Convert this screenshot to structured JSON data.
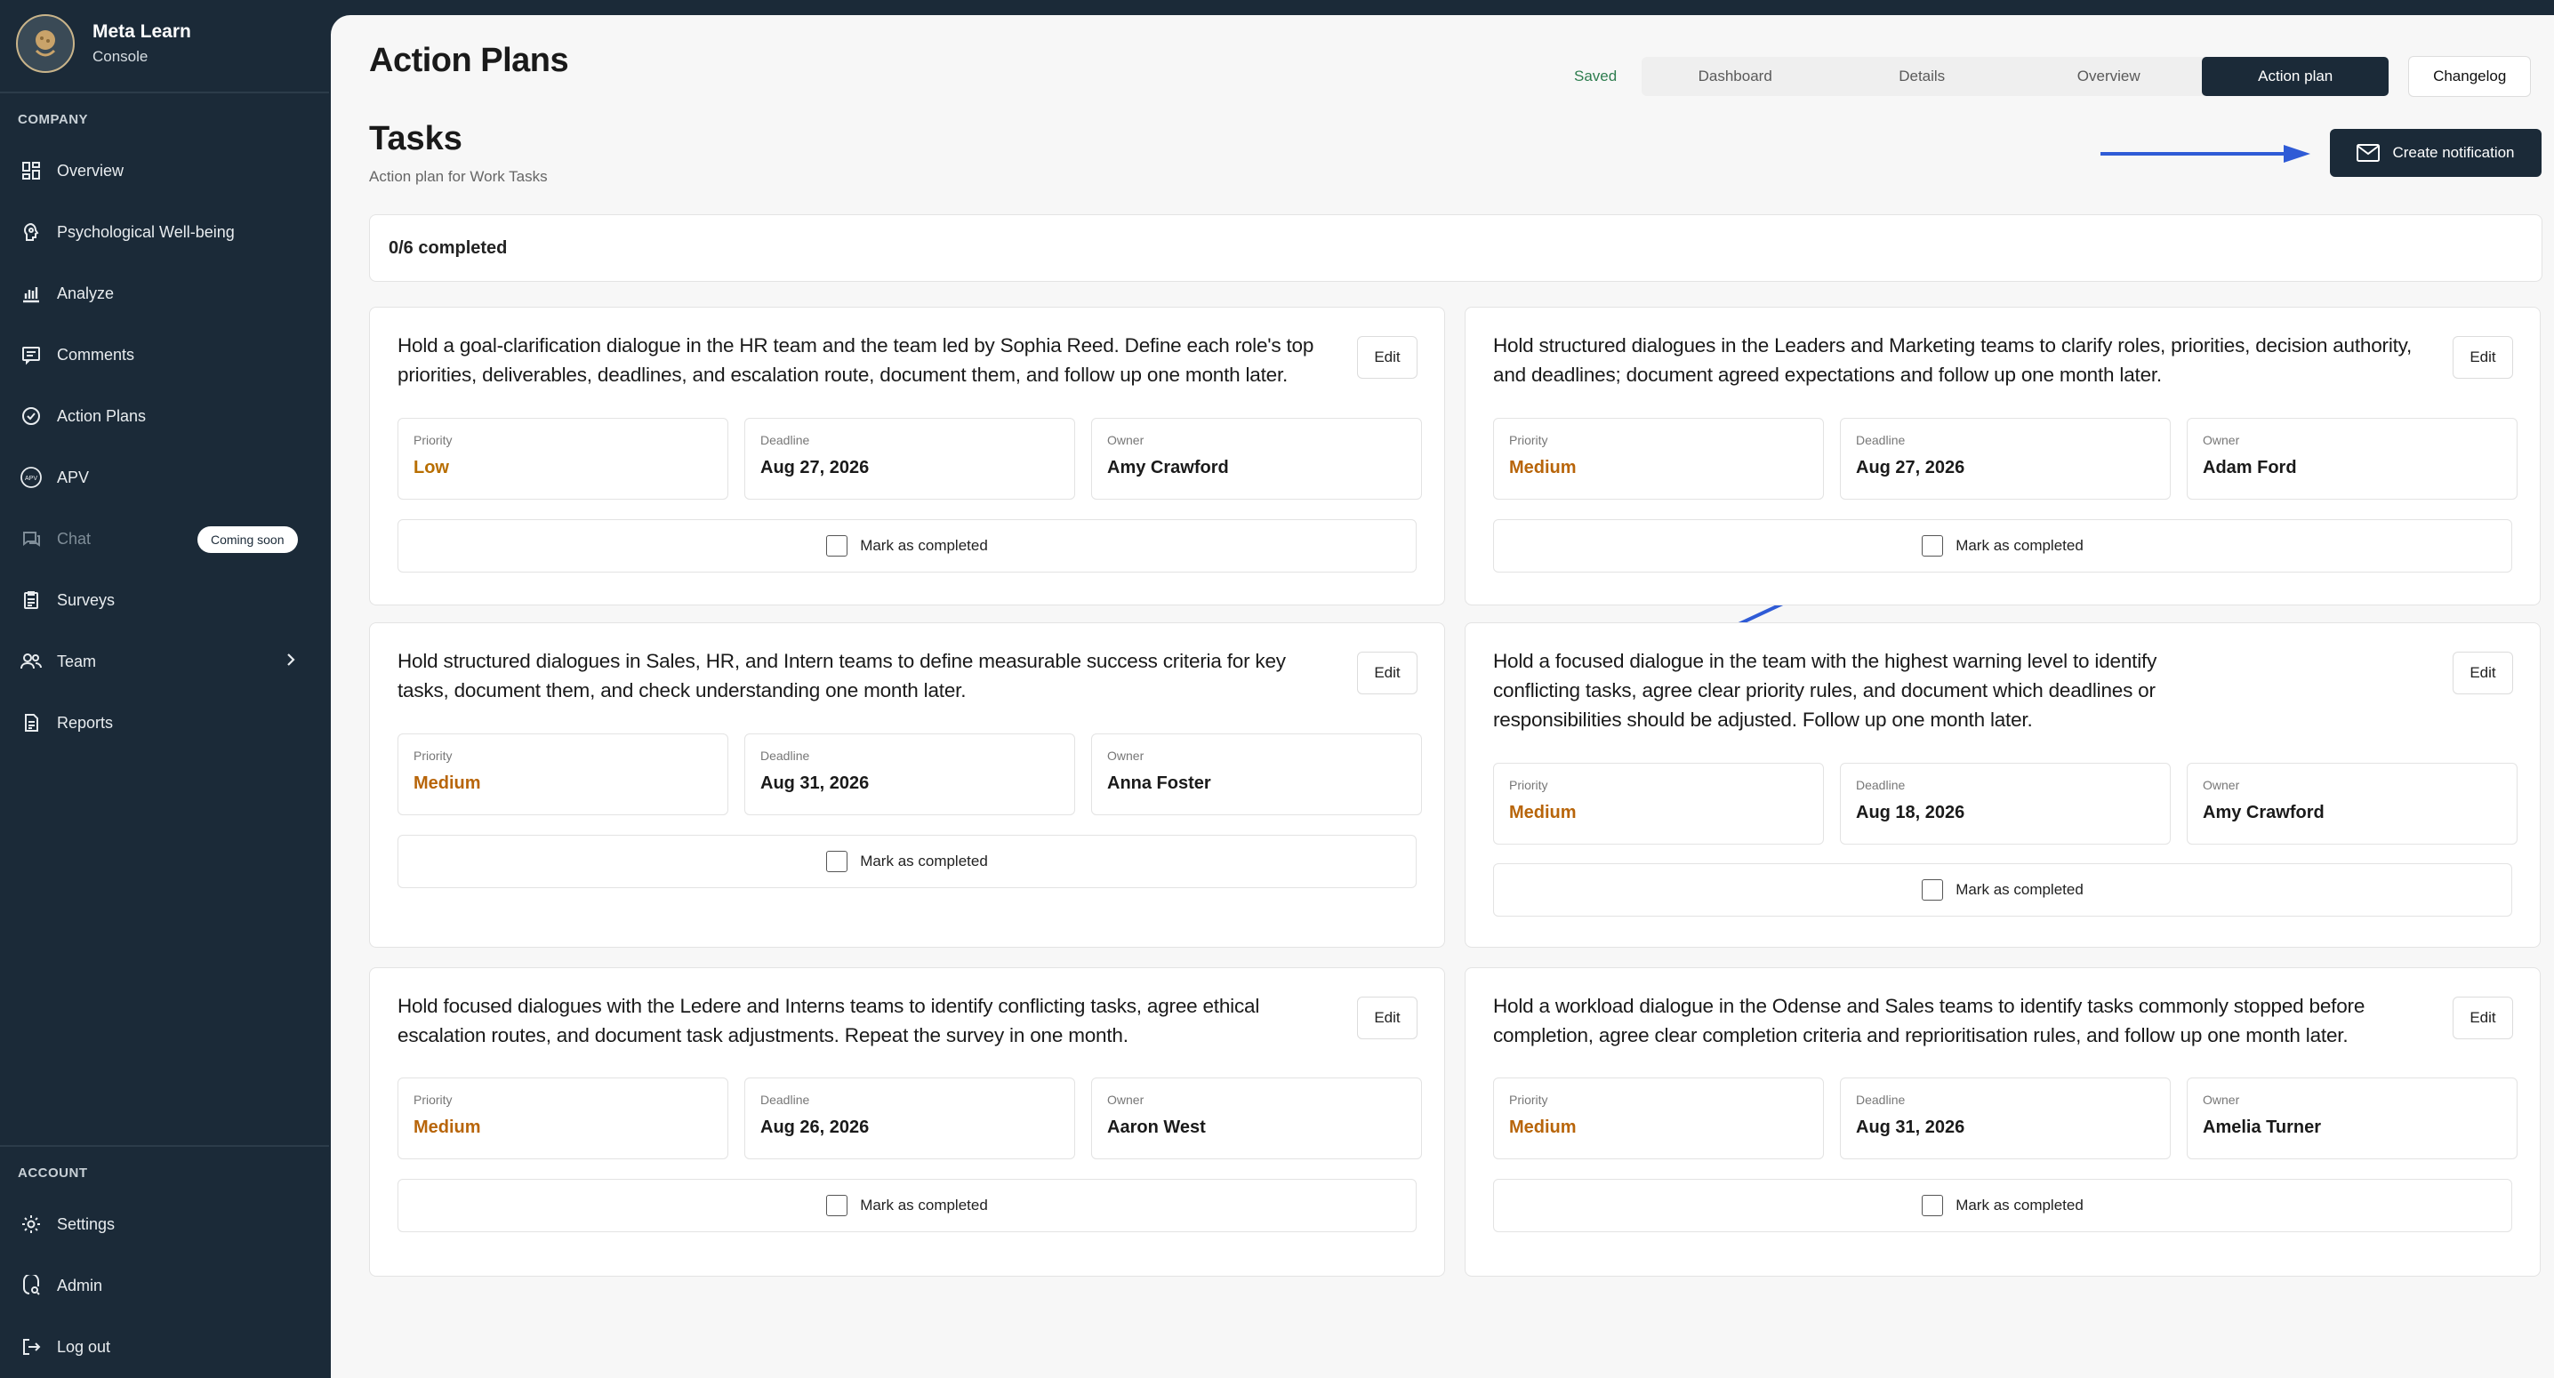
{
  "brand": {
    "name": "Meta Learn",
    "subtitle": "Console"
  },
  "sidebar": {
    "company_label": "COMPANY",
    "items": [
      {
        "label": "Overview",
        "icon": "dashboard-grid-icon"
      },
      {
        "label": "Psychological Well-being",
        "icon": "head-brain-icon"
      },
      {
        "label": "Analyze",
        "icon": "bar-chart-icon"
      },
      {
        "label": "Comments",
        "icon": "comment-icon"
      },
      {
        "label": "Action Plans",
        "icon": "check-circle-icon"
      },
      {
        "label": "APV",
        "icon": "apv-badge-icon"
      },
      {
        "label": "Chat",
        "icon": "chat-icon",
        "badge": "Coming soon",
        "disabled": true
      },
      {
        "label": "Surveys",
        "icon": "clipboard-icon"
      },
      {
        "label": "Team",
        "icon": "users-icon",
        "expandable": true
      },
      {
        "label": "Reports",
        "icon": "document-icon"
      }
    ],
    "account_label": "ACCOUNT",
    "account_items": [
      {
        "label": "Settings",
        "icon": "gear-icon"
      },
      {
        "label": "Admin",
        "icon": "admin-shield-icon"
      },
      {
        "label": "Log out",
        "icon": "logout-icon"
      }
    ]
  },
  "header": {
    "title": "Action Plans",
    "saved": "Saved",
    "tabs": [
      "Dashboard",
      "Details",
      "Overview",
      "Action plan"
    ],
    "active_tab": "Action plan",
    "changelog": "Changelog"
  },
  "tasks": {
    "title": "Tasks",
    "subtitle": "Action plan for Work Tasks",
    "create_button": "Create notification",
    "progress": "0/6 completed"
  },
  "labels": {
    "priority": "Priority",
    "deadline": "Deadline",
    "owner": "Owner",
    "edit": "Edit",
    "mark_completed": "Mark as completed"
  },
  "cards": [
    {
      "description": "Hold a goal-clarification dialogue in the HR team and the team led by Sophia Reed. Define each role's top priorities, deliverables, deadlines, and escalation route, document them, and follow up one month later.",
      "priority": "Low",
      "deadline": "Aug 27, 2026",
      "owner": "Amy Crawford"
    },
    {
      "description": "Hold structured dialogues in the Leaders and Marketing teams to clarify roles, priorities, decision authority, and deadlines; document agreed expectations and follow up one month later.",
      "priority": "Medium",
      "deadline": "Aug 27, 2026",
      "owner": "Adam Ford"
    },
    {
      "description": "Hold structured dialogues in Sales, HR, and Intern teams to define measurable success criteria for key tasks, document them, and check understanding one month later.",
      "priority": "Medium",
      "deadline": "Aug 31, 2026",
      "owner": "Anna Foster"
    },
    {
      "description": "Hold a focused dialogue in the team with the highest warning level to identify conflicting tasks, agree clear priority rules, and document which deadlines or responsibilities should be adjusted. Follow up one month later.",
      "priority": "Medium",
      "deadline": "Aug 18, 2026",
      "owner": "Amy Crawford"
    },
    {
      "description": "Hold focused dialogues with the Ledere and Interns teams to identify conflicting tasks, agree ethical escalation routes, and document task adjustments. Repeat the survey in one month.",
      "priority": "Medium",
      "deadline": "Aug 26, 2026",
      "owner": "Aaron West"
    },
    {
      "description": "Hold a workload dialogue in the Odense and Sales teams to identify tasks commonly stopped before completion, agree clear completion criteria and reprioritisation rules, and follow up one month later.",
      "priority": "Medium",
      "deadline": "Aug 31, 2026",
      "owner": "Amelia Turner"
    }
  ],
  "colors": {
    "sidebar": "#1b2a38",
    "accent_arrow": "#2f5bd6",
    "priority_low": "#b86e00",
    "priority_medium": "#b8650a",
    "saved": "#2e7d4f"
  }
}
